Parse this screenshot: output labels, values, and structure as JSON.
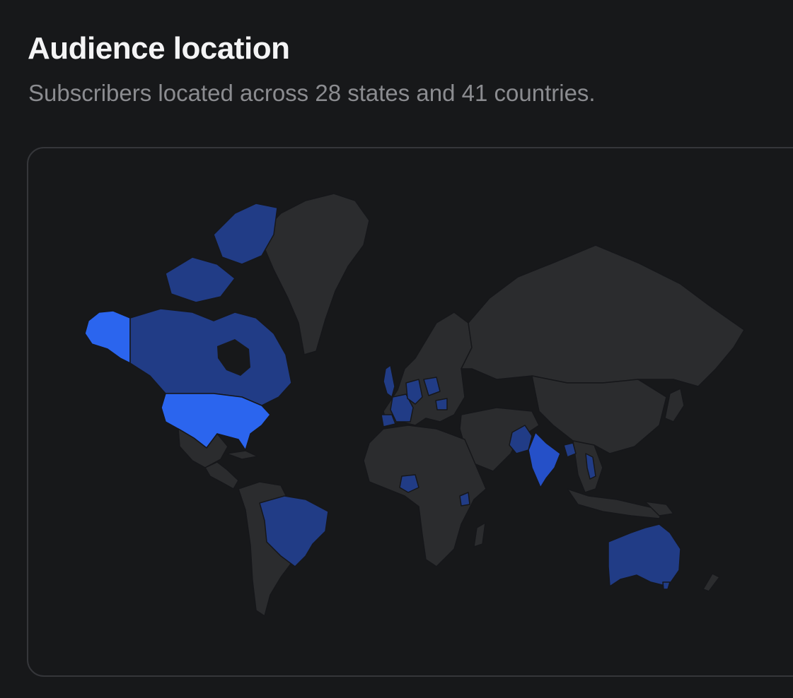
{
  "header": {
    "title": "Audience location",
    "subtitle": "Subscribers located across 28 states and 41 countries."
  },
  "colors": {
    "background": "#17181a",
    "land_default": "#2b2c2e",
    "border": "#16171a",
    "card_border": "#35363a",
    "high": "#2b65ee",
    "medium": "#2550c8",
    "low": "#213c86"
  },
  "regions": [
    {
      "name": "Alaska",
      "level": "high"
    },
    {
      "name": "Canada",
      "level": "low"
    },
    {
      "name": "United States",
      "level": "high"
    },
    {
      "name": "Brazil",
      "level": "low"
    },
    {
      "name": "United Kingdom",
      "level": "low"
    },
    {
      "name": "France",
      "level": "low"
    },
    {
      "name": "Germany",
      "level": "low"
    },
    {
      "name": "Poland",
      "level": "low"
    },
    {
      "name": "Romania",
      "level": "low"
    },
    {
      "name": "Spain",
      "level": "low"
    },
    {
      "name": "Nigeria",
      "level": "low"
    },
    {
      "name": "Kenya",
      "level": "low"
    },
    {
      "name": "Pakistan",
      "level": "low"
    },
    {
      "name": "India",
      "level": "medium"
    },
    {
      "name": "Bangladesh",
      "level": "low"
    },
    {
      "name": "Vietnam",
      "level": "low"
    },
    {
      "name": "Australia",
      "level": "low"
    }
  ]
}
